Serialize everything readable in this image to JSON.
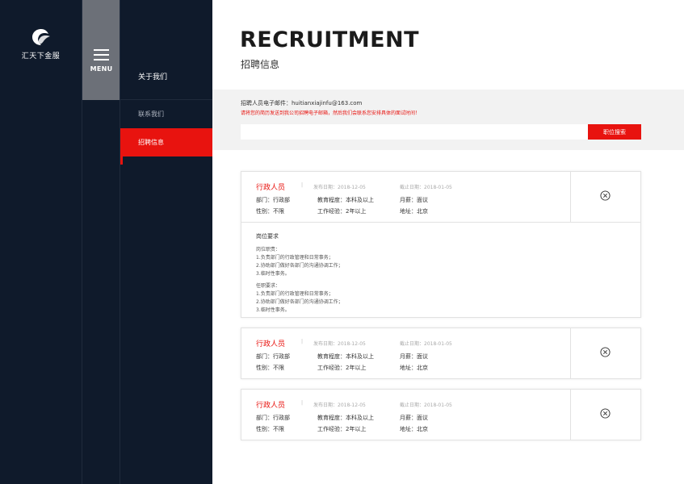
{
  "brand": {
    "logo_text": "汇天下金服",
    "logo_icon": "crescent-swirl-logo"
  },
  "menu": {
    "label": "MENU",
    "icon": "hamburger-icon"
  },
  "nav": {
    "heading": "关于我们",
    "items": [
      {
        "label": "联系我们",
        "active": false
      },
      {
        "label": "招聘信息",
        "active": true
      }
    ]
  },
  "header": {
    "title": "RECRUITMENT",
    "subtitle": "招聘信息"
  },
  "search": {
    "email_line": "招聘人员电子邮件：huitianxiajinfu@163.com",
    "notice": "请将您的简历发送到我公司招聘电子邮箱，然后我们会联系您安排具体的面试时间！",
    "placeholder": "",
    "button_label": "职位搜索"
  },
  "jobs": [
    {
      "title": "行政人员",
      "sep": "|",
      "published": "发布日期：2018-12-05",
      "deadline": "截止日期：2018-01-05",
      "department": "部门：行政部",
      "education": "教育程度：本科及以上",
      "salary": "月薪：面议",
      "gender": "性别：不限",
      "experience": "工作经验：2年以上",
      "address": "地址：北京",
      "expanded": true,
      "requirements_heading": "岗位要求",
      "duties_heading": "岗位职责：",
      "duties": [
        "1.负责部门的行政管理和日常事务；",
        "2.协助部门做好各部门的沟通协调工作；",
        "3.临时性事务。"
      ],
      "qualifications_heading": "任职要求：",
      "qualifications": [
        "1.负责部门的行政管理和日常事务；",
        "2.协助部门做好各部门的沟通协调工作；",
        "3.临时性事务。"
      ]
    },
    {
      "title": "行政人员",
      "sep": "|",
      "published": "发布日期：2018-12-05",
      "deadline": "截止日期：2018-01-05",
      "department": "部门：行政部",
      "education": "教育程度：本科及以上",
      "salary": "月薪：面议",
      "gender": "性别：不限",
      "experience": "工作经验：2年以上",
      "address": "地址：北京",
      "expanded": false
    },
    {
      "title": "行政人员",
      "sep": "|",
      "published": "发布日期：2018-12-05",
      "deadline": "截止日期：2018-01-05",
      "department": "部门：行政部",
      "education": "教育程度：本科及以上",
      "salary": "月薪：面议",
      "gender": "性别：不限",
      "experience": "工作经验：2年以上",
      "address": "地址：北京",
      "expanded": false
    }
  ],
  "colors": {
    "accent": "#e8130f",
    "sidebar": "#0f1a2b",
    "menu_button": "#6c7078",
    "band": "#f2f2f2"
  }
}
